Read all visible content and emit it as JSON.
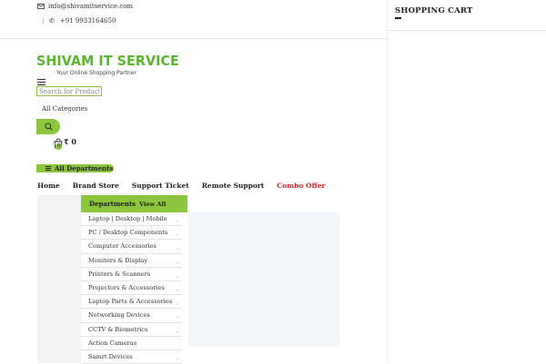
{
  "topbar": {
    "email": "info@shivamitservice.com",
    "phone": "+91 9933164650"
  },
  "cart_panel": {
    "title": "SHOPPING CART"
  },
  "logo": {
    "name": "SHIVAM IT SERVICE",
    "tagline": "Your Online Shopping Partner"
  },
  "search": {
    "placeholder": "Search for Products",
    "category_label": "All Categories"
  },
  "cart": {
    "count": "0",
    "amount": "₹ 0"
  },
  "all_departments_label": "All Departments",
  "nav": [
    {
      "label": "Home"
    },
    {
      "label": "Brand Store"
    },
    {
      "label": "Support Ticket"
    },
    {
      "label": "Remote Support"
    },
    {
      "label": "Combo Offer"
    }
  ],
  "departments": {
    "title": "Departments",
    "view_all": "View All",
    "items": [
      "Laptop | Desktop | Mobile",
      "PC / Desktop Components",
      "Computer Accessories",
      "Monitors & Display",
      "Printers & Scanners",
      "Projectors & Accessories",
      "Laptop Parts & Accessories",
      "Networking Devices",
      "CCTV & Biometrics",
      "Action Cameras",
      "Samrt Devices"
    ]
  },
  "colors": {
    "accent": "#8cc63f",
    "logo_green": "#5cb531",
    "combo_red": "#d3232a"
  }
}
